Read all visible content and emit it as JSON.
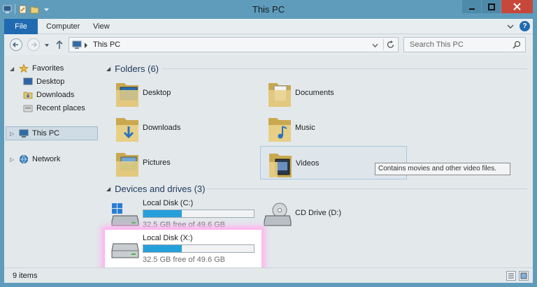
{
  "window": {
    "title": "This PC"
  },
  "ribbon": {
    "tabs": [
      "File",
      "Computer",
      "View"
    ]
  },
  "address": {
    "path": "This PC",
    "search_placeholder": "Search This PC"
  },
  "nav": {
    "favorites": "Favorites",
    "favorite_items": [
      "Desktop",
      "Downloads",
      "Recent places"
    ],
    "this_pc": "This PC",
    "network": "Network"
  },
  "folders": {
    "header": "Folders (6)",
    "items": [
      "Desktop",
      "Documents",
      "Downloads",
      "Music",
      "Pictures",
      "Videos"
    ],
    "tooltip": "Contains movies and other video files."
  },
  "drives": {
    "header": "Devices and drives (3)",
    "items": [
      {
        "name": "Local Disk (C:)",
        "free": "32.5 GB free of 49.6 GB",
        "used_fraction": 0.345
      },
      {
        "name": "CD Drive (D:)"
      },
      {
        "name": "Local Disk (X:)",
        "free": "32.5 GB free of 49.6 GB",
        "used_fraction": 0.345
      }
    ]
  },
  "status": {
    "count": "9 items"
  },
  "colors": {
    "accent": "#1f6ab1",
    "frame": "#5f9cbb",
    "bar_fill": "#26a0da",
    "close": "#c7473a"
  }
}
